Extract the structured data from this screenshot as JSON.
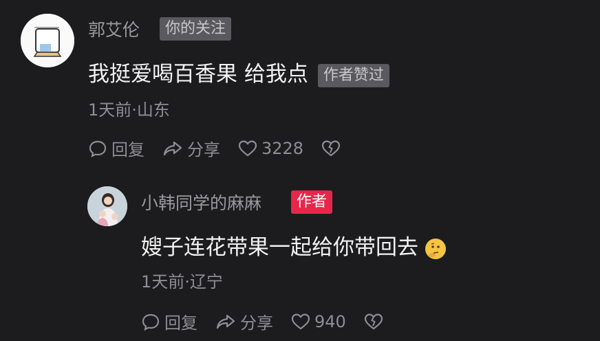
{
  "comments": [
    {
      "user": "郭艾伦",
      "follow_tag": "你的关注",
      "text": "我挺爱喝百香果 给我点",
      "liked_tag": "作者赞过",
      "meta": "1天前·山东",
      "reply_label": "回复",
      "share_label": "分享",
      "likes": "3228"
    },
    {
      "user": "小韩同学的麻麻",
      "author_tag": "作者",
      "text": "嫂子连花带果一起给你带回去",
      "meta": "1天前·辽宁",
      "reply_label": "回复",
      "share_label": "分享",
      "likes": "940"
    }
  ],
  "colors": {
    "background": "#1c1c1e",
    "author_tag": "#e8264a"
  }
}
